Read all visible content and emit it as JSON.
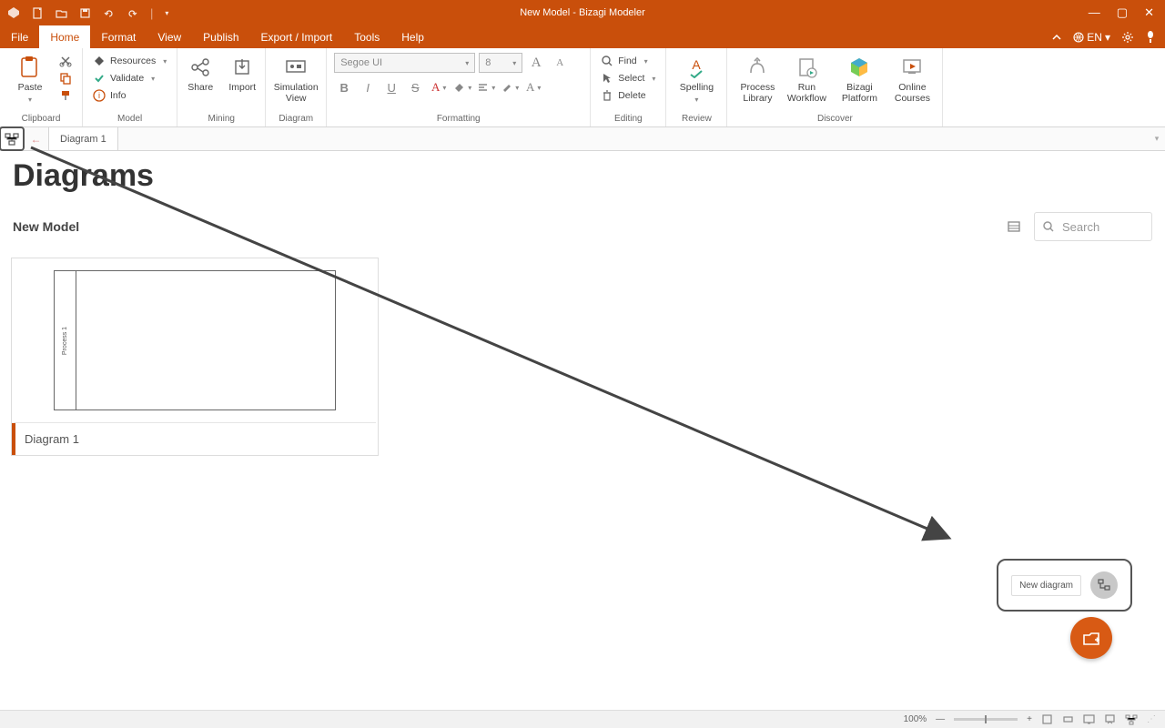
{
  "window": {
    "title": "New Model - Bizagi Modeler"
  },
  "menu": {
    "tabs": [
      "File",
      "Home",
      "Format",
      "View",
      "Publish",
      "Export / Import",
      "Tools",
      "Help"
    ],
    "active": 1,
    "lang": "EN"
  },
  "ribbon": {
    "clipboard": {
      "paste": "Paste",
      "label": "Clipboard"
    },
    "model": {
      "resources": "Resources",
      "validate": "Validate",
      "info": "Info",
      "label": "Model"
    },
    "share": {
      "share": "Share",
      "import": "Import",
      "label": "Mining"
    },
    "diagram": {
      "sim": "Simulation View",
      "label": "Diagram"
    },
    "formatting": {
      "font_name": "Segoe UI",
      "font_size": "8",
      "label": "Formatting"
    },
    "editing": {
      "find": "Find",
      "select": "Select",
      "delete": "Delete",
      "label": "Editing"
    },
    "review": {
      "spelling": "Spelling",
      "label": "Review"
    },
    "discover": {
      "plib": "Process Library",
      "run": "Run Workflow",
      "platform": "Bizagi Platform",
      "courses": "Online Courses",
      "label": "Discover"
    }
  },
  "tabs": {
    "diagram1": "Diagram 1"
  },
  "page": {
    "title": "Diagrams",
    "model_name": "New Model",
    "search_placeholder": "Search",
    "card_label": "Diagram 1",
    "pool_label": "Process 1",
    "new_diagram": "New diagram"
  },
  "status": {
    "zoom": "100%"
  }
}
